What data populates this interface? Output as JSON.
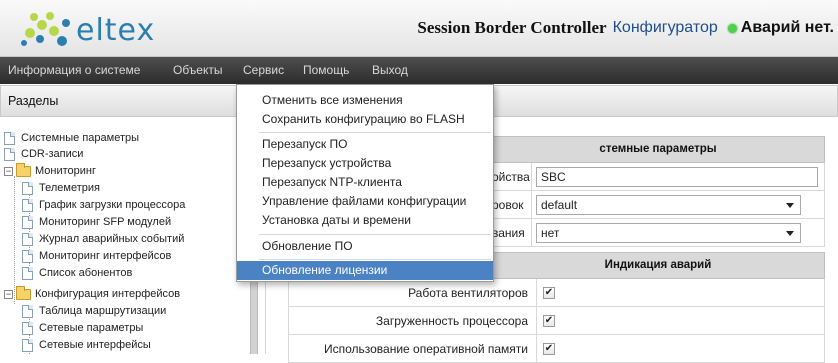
{
  "header": {
    "logo_text": "eltex",
    "product": "Session Border Controller",
    "subtitle": "Конфигуратор",
    "alarm_status": "Аварий нет.",
    "alarm_color": "#4cd14c"
  },
  "menu": {
    "items": [
      "Информация о системе",
      "Объекты",
      "Сервис",
      "Помощь",
      "Выход"
    ]
  },
  "sidebar": {
    "title": "Разделы",
    "tree": [
      {
        "label": "Системные параметры",
        "type": "doc",
        "level": 0
      },
      {
        "label": "CDR-записи",
        "type": "doc",
        "level": 0
      },
      {
        "label": "Мониторинг",
        "type": "folder",
        "level": 0
      },
      {
        "label": "Телеметрия",
        "type": "doc",
        "level": 1
      },
      {
        "label": "График загрузки процессора",
        "type": "doc",
        "level": 1
      },
      {
        "label": "Мониторинг SFP модулей",
        "type": "doc",
        "level": 1
      },
      {
        "label": "Журнал аварийных событий",
        "type": "doc",
        "level": 1
      },
      {
        "label": "Мониторинг интерфейсов",
        "type": "doc",
        "level": 1
      },
      {
        "label": "Список абонентов",
        "type": "doc",
        "level": 1
      },
      {
        "label": "Конфигурация интерфейсов",
        "type": "folder",
        "level": 0
      },
      {
        "label": "Таблица маршрутизации",
        "type": "doc",
        "level": 1
      },
      {
        "label": "Сетевые параметры",
        "type": "doc",
        "level": 1
      },
      {
        "label": "Сетевые интерфейсы",
        "type": "doc",
        "level": 1
      }
    ]
  },
  "dropdown": {
    "items": [
      "Отменить все изменения",
      "Сохранить конфигурацию во FLASH",
      "Перезапуск ПО",
      "Перезапуск устройства",
      "Перезапуск NTP-клиента",
      "Управление файлами конфигурации",
      "Установка даты и времени",
      "Обновление ПО",
      "Обновление лицензии"
    ],
    "active_index": 8
  },
  "main": {
    "section1_title": "стемные параметры",
    "fields": [
      {
        "label": "ойства",
        "value": "SBC"
      },
      {
        "label": "ровок",
        "value": "default"
      },
      {
        "label": "вания",
        "value": "нет"
      }
    ],
    "section2_title": "Индикация аварий",
    "alarms": [
      {
        "label": "Работа вентиляторов",
        "checked": true
      },
      {
        "label": "Загруженность процессора",
        "checked": true
      },
      {
        "label": "Использование оперативной памяти",
        "checked": true
      }
    ]
  }
}
